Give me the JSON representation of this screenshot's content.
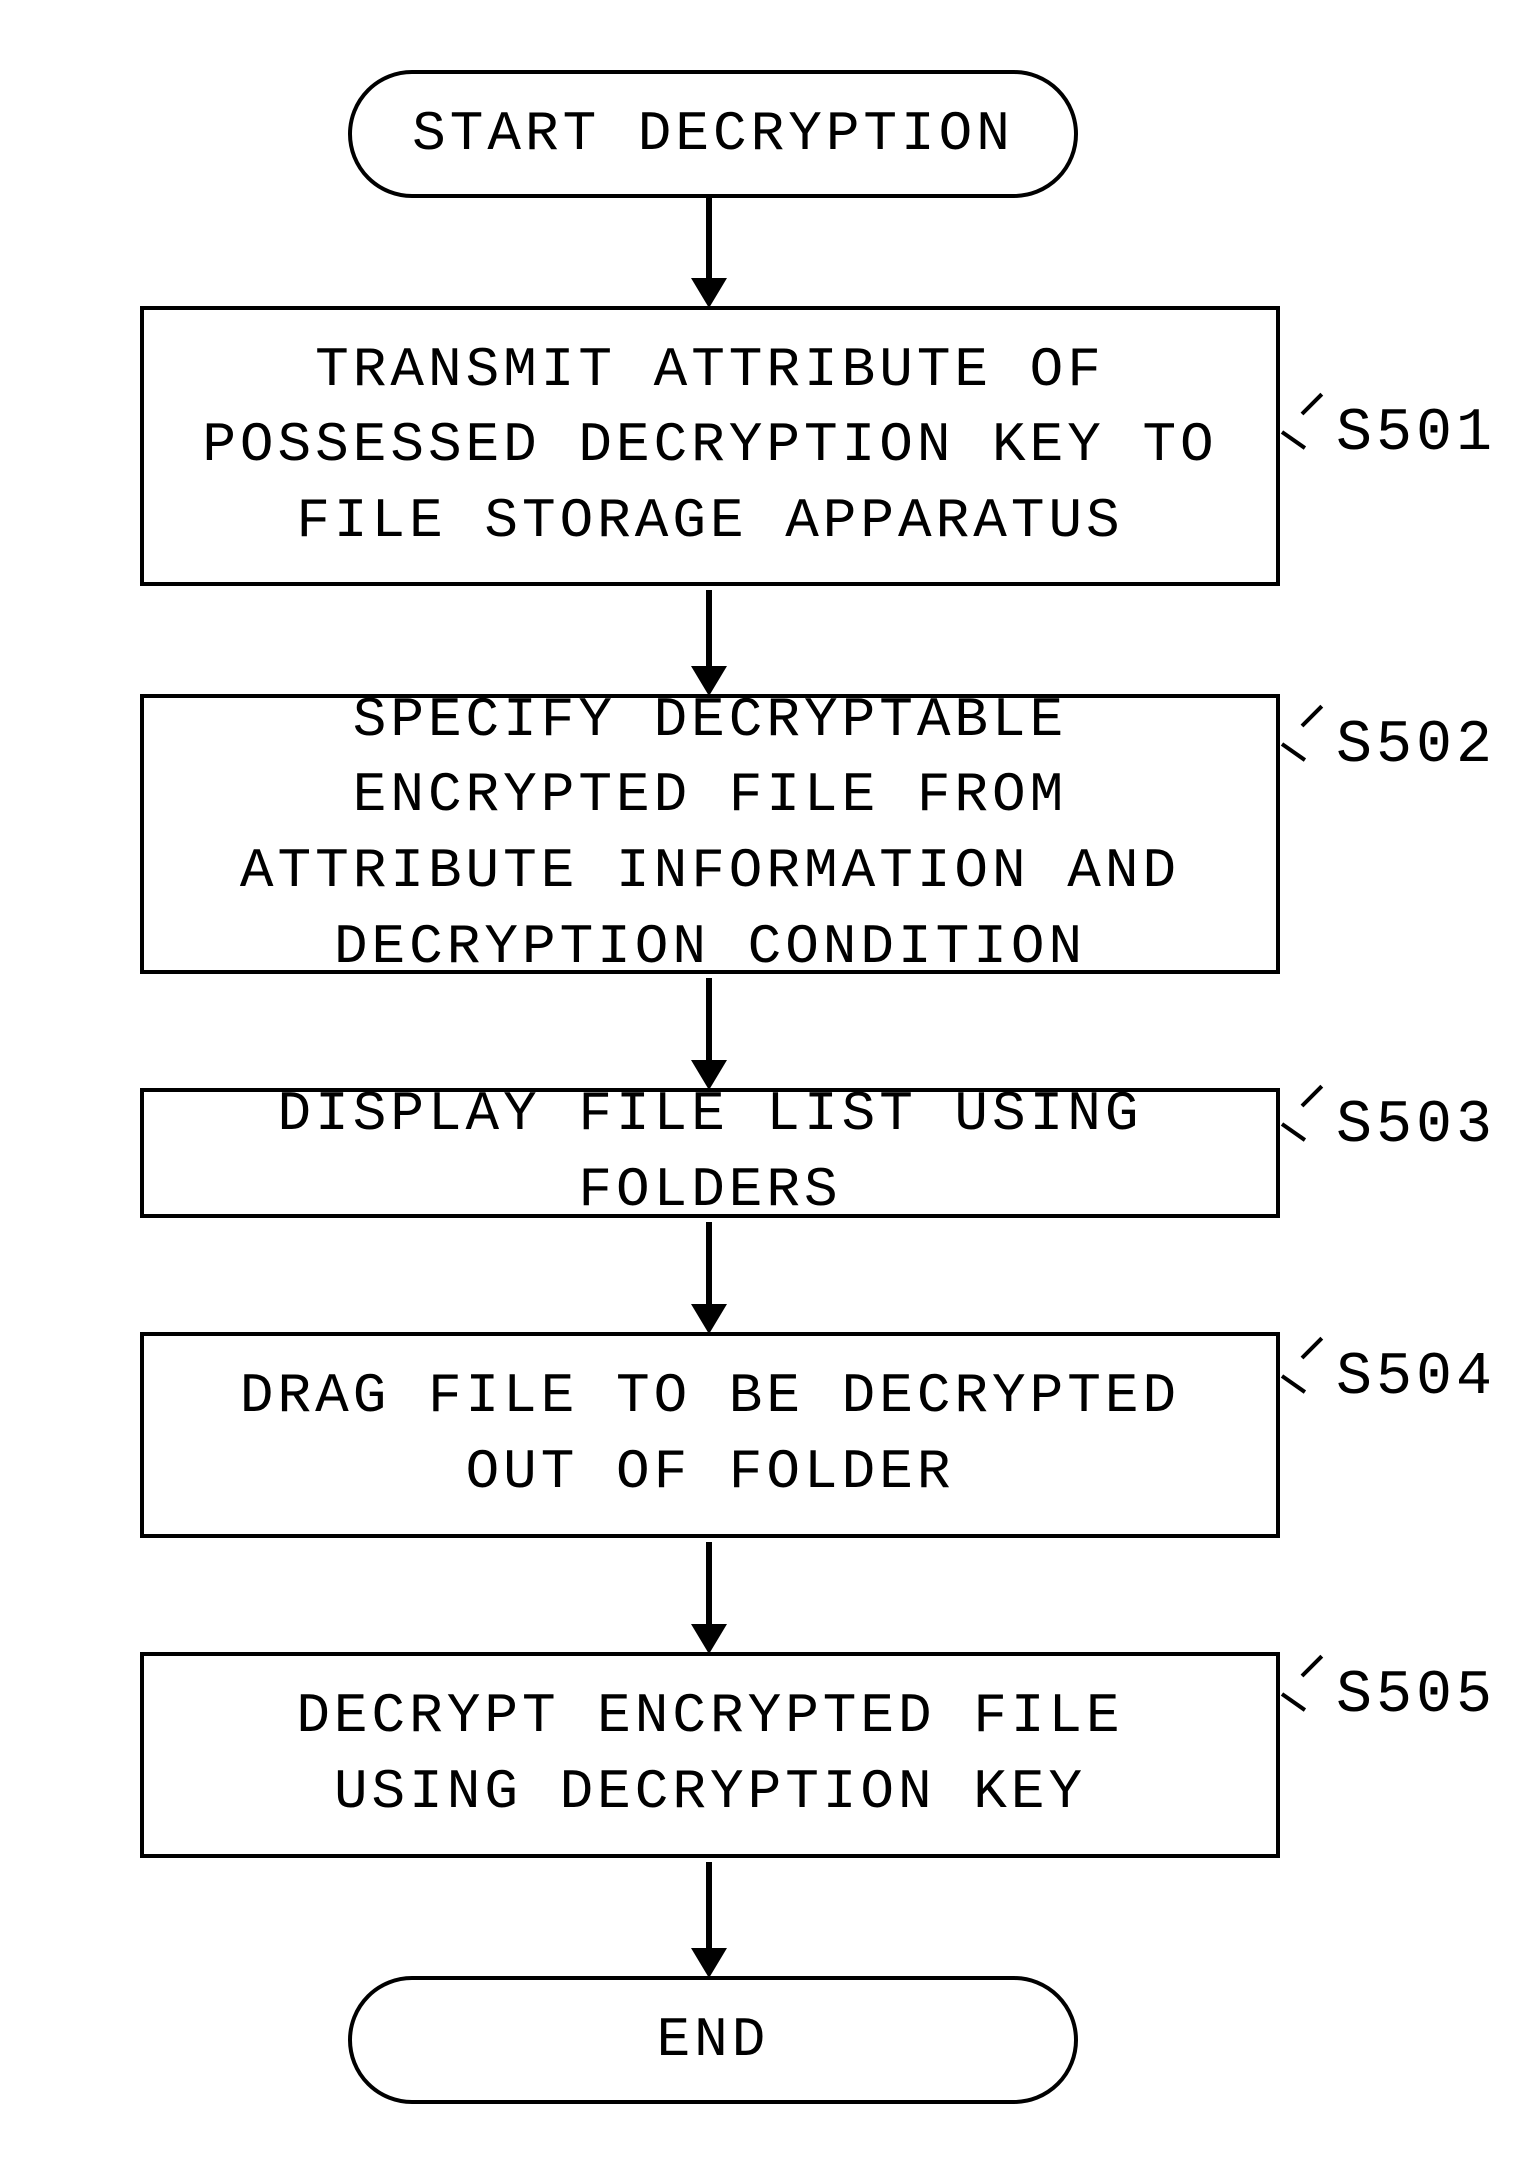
{
  "flow": {
    "start": "START DECRYPTION",
    "end": "END",
    "steps": [
      {
        "id": "S501",
        "text": "TRANSMIT ATTRIBUTE OF POSSESSED DECRYPTION KEY TO FILE STORAGE APPARATUS"
      },
      {
        "id": "S502",
        "text": "SPECIFY DECRYPTABLE ENCRYPTED FILE FROM ATTRIBUTE INFORMATION AND DECRYPTION CONDITION"
      },
      {
        "id": "S503",
        "text": "DISPLAY FILE LIST USING FOLDERS"
      },
      {
        "id": "S504",
        "text": "DRAG FILE TO BE DECRYPTED OUT OF FOLDER"
      },
      {
        "id": "S505",
        "text": "DECRYPT ENCRYPTED FILE USING DECRYPTION KEY"
      }
    ]
  }
}
